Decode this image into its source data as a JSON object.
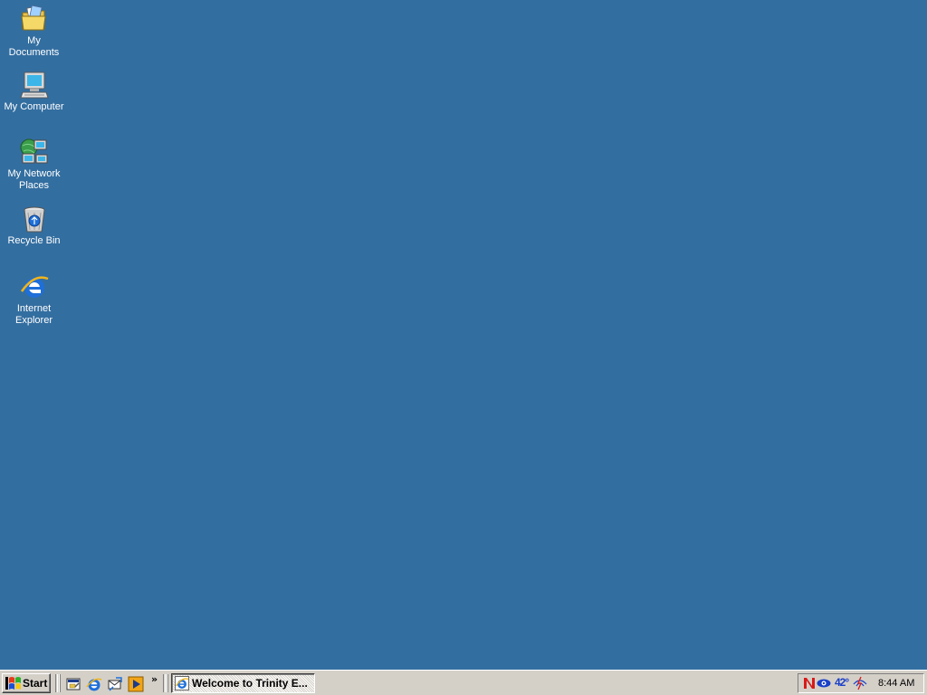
{
  "desktop": {
    "background_color": "#336ea0",
    "icons": [
      {
        "label": "My Documents",
        "icon": "folder-documents-icon"
      },
      {
        "label": "My Computer",
        "icon": "computer-icon"
      },
      {
        "label": "My Network Places",
        "icon": "network-places-icon"
      },
      {
        "label": "Recycle Bin",
        "icon": "recycle-bin-icon"
      },
      {
        "label": "Internet Explorer",
        "icon": "internet-explorer-icon"
      }
    ]
  },
  "taskbar": {
    "start_label": "Start",
    "quick_launch": [
      {
        "icon": "show-desktop-icon"
      },
      {
        "icon": "internet-explorer-icon"
      },
      {
        "icon": "outlook-express-icon"
      },
      {
        "icon": "media-player-icon"
      }
    ],
    "more_label": "»",
    "active_task": {
      "label": "Welcome to Trinity E...",
      "icon": "internet-explorer-icon"
    },
    "tray": {
      "icons": [
        "norton-icon",
        "weather-eye-icon",
        "wireless-icon"
      ],
      "temperature": "42°",
      "clock": "8:44 AM"
    }
  }
}
